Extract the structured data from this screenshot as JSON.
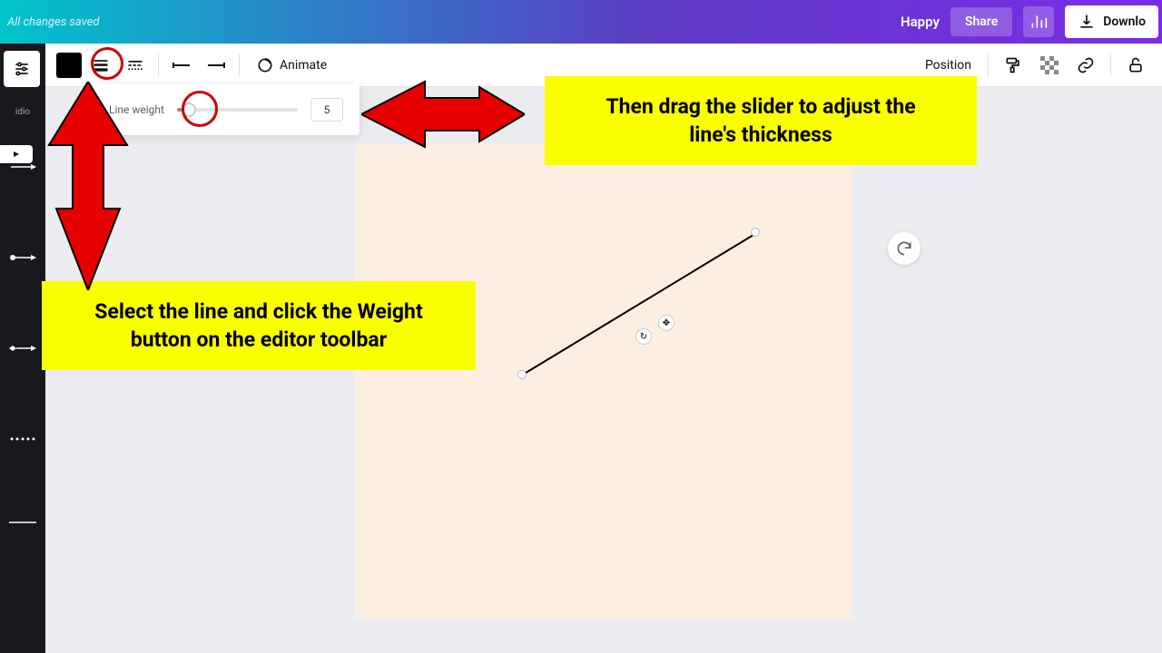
{
  "header": {
    "saved_status": "All changes saved",
    "happy_label": "Happy",
    "share_label": "Share",
    "download_label": "Downlo"
  },
  "toolbar": {
    "color_value": "#000000",
    "animate_label": "Animate",
    "position_label": "Position"
  },
  "left_rail": {
    "label": "idio"
  },
  "weight_popup": {
    "label": "Line weight",
    "value": "5"
  },
  "callouts": {
    "c1_line1": "Select the line and click the Weight",
    "c1_line2": "button on the editor toolbar",
    "c2_line1": "Then drag the slider to adjust the",
    "c2_line2": "line's thickness"
  },
  "icons": {
    "stats": "stats-icon",
    "download": "download-icon",
    "weight": "line-weight-icon",
    "style": "line-style-icon",
    "start": "line-start-icon",
    "end": "line-end-icon",
    "animate": "animate-circle-icon",
    "copystyle": "paint-roller-icon",
    "transparency": "transparency-icon",
    "link": "link-icon",
    "lock": "lock-icon",
    "settings": "settings-sliders-icon",
    "arrow_r": "tab-arrow-right-icon",
    "rotate": "rotate-icon",
    "move": "move-icon",
    "refresh": "refresh-icon"
  }
}
